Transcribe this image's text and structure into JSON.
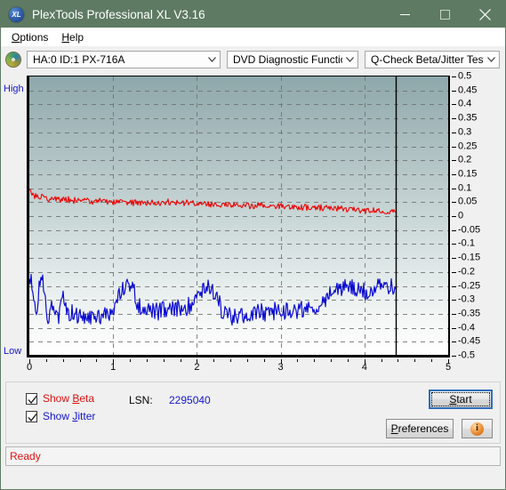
{
  "window": {
    "title": "PlexTools Professional XL V3.16",
    "app_icon": "xl-disc-icon",
    "minimize_label": "Minimize",
    "maximize_label": "Maximize",
    "close_label": "Close"
  },
  "menu": {
    "items": [
      {
        "label": "Options",
        "accel": "O"
      },
      {
        "label": "Help",
        "accel": "H"
      }
    ]
  },
  "toolbar": {
    "drive_icon": "optical-disc-icon",
    "drive_select": "HA:0 ID:1  PX-716A",
    "function_select": "DVD Diagnostic Functions",
    "test_select": "Q-Check Beta/Jitter Test"
  },
  "chart_labels": {
    "high": "High",
    "low": "Low"
  },
  "controls": {
    "show_beta": {
      "label": "Show Beta",
      "accel": "B",
      "checked": true,
      "color": "#e01010"
    },
    "show_jitter": {
      "label": "Show Jitter",
      "accel": "J",
      "checked": true,
      "color": "#1414d2"
    },
    "lsn_label": "LSN:",
    "lsn_value": "2295040",
    "start_label": "Start",
    "start_accel": "S",
    "preferences_label": "Preferences",
    "preferences_accel": "P",
    "info_label": "i",
    "info_icon": "info-icon"
  },
  "status": {
    "text": "Ready"
  },
  "colors": {
    "title_bar": "#5e7a63",
    "beta_line": "#f00000",
    "jitter_line": "#0a0ad2",
    "axis_label_blue": "#1414d2",
    "status_red": "#e01010",
    "plot_top": "#8ea8ab",
    "plot_bottom": "#ffffff"
  },
  "chart_data": {
    "type": "line",
    "title": "Q-Check Beta/Jitter Test",
    "xlabel": "",
    "ylabel": "",
    "xlim": [
      0,
      5
    ],
    "ylim": [
      -0.5,
      0.5
    ],
    "grid": true,
    "legend": "checkbox-toggles",
    "xticks": [
      0,
      1,
      2,
      3,
      4,
      5
    ],
    "yticks": [
      0.5,
      0.45,
      0.4,
      0.35,
      0.3,
      0.25,
      0.2,
      0.15,
      0.1,
      0.05,
      0,
      -0.05,
      -0.1,
      -0.15,
      -0.2,
      -0.25,
      -0.3,
      -0.35,
      -0.4,
      -0.45,
      -0.5
    ],
    "data_end_x": 4.37,
    "marker_line_x": 4.37,
    "axis_side_labels": {
      "top_left": "High",
      "bottom_left": "Low"
    },
    "series": [
      {
        "name": "Beta",
        "color": "#f00000",
        "x": [
          0.0,
          0.02,
          0.04,
          0.06,
          0.09,
          0.13,
          0.18,
          0.24,
          0.31,
          0.39,
          0.48,
          0.57,
          0.66,
          0.76,
          0.86,
          0.96,
          1.06,
          1.16,
          1.26,
          1.36,
          1.46,
          1.56,
          1.66,
          1.76,
          1.86,
          1.96,
          2.06,
          2.16,
          2.26,
          2.36,
          2.46,
          2.56,
          2.66,
          2.76,
          2.86,
          2.96,
          3.06,
          3.16,
          3.26,
          3.36,
          3.46,
          3.56,
          3.66,
          3.76,
          3.86,
          3.96,
          4.06,
          4.16,
          4.26,
          4.37
        ],
        "y": [
          0.095,
          0.085,
          0.075,
          0.072,
          0.07,
          0.068,
          0.066,
          0.064,
          0.063,
          0.06,
          0.058,
          0.056,
          0.055,
          0.054,
          0.052,
          0.051,
          0.05,
          0.05,
          0.049,
          0.048,
          0.047,
          0.044,
          0.05,
          0.048,
          0.047,
          0.045,
          0.044,
          0.043,
          0.042,
          0.041,
          0.04,
          0.038,
          0.036,
          0.038,
          0.036,
          0.034,
          0.033,
          0.032,
          0.031,
          0.03,
          0.029,
          0.028,
          0.027,
          0.026,
          0.024,
          0.022,
          0.021,
          0.02,
          0.018,
          0.016
        ],
        "noise_amplitude": 0.01
      },
      {
        "name": "Jitter",
        "color": "#0a0ad2",
        "x": [
          0.0,
          0.03,
          0.06,
          0.09,
          0.12,
          0.15,
          0.18,
          0.22,
          0.26,
          0.3,
          0.35,
          0.4,
          0.46,
          0.52,
          0.58,
          0.64,
          0.7,
          0.76,
          0.82,
          0.88,
          0.94,
          1.0,
          1.06,
          1.12,
          1.18,
          1.22,
          1.26,
          1.3,
          1.36,
          1.42,
          1.48,
          1.54,
          1.6,
          1.66,
          1.72,
          1.78,
          1.84,
          1.9,
          1.96,
          2.02,
          2.08,
          2.14,
          2.2,
          2.26,
          2.32,
          2.38,
          2.44,
          2.5,
          2.58,
          2.66,
          2.74,
          2.82,
          2.9,
          2.98,
          3.06,
          3.14,
          3.22,
          3.3,
          3.38,
          3.46,
          3.54,
          3.62,
          3.7,
          3.78,
          3.86,
          3.94,
          4.02,
          4.1,
          4.18,
          4.26,
          4.32,
          4.37
        ],
        "y": [
          -0.215,
          -0.245,
          -0.3,
          -0.345,
          -0.255,
          -0.225,
          -0.255,
          -0.385,
          -0.31,
          -0.33,
          -0.355,
          -0.3,
          -0.335,
          -0.35,
          -0.36,
          -0.365,
          -0.362,
          -0.358,
          -0.355,
          -0.348,
          -0.345,
          -0.34,
          -0.3,
          -0.26,
          -0.24,
          -0.25,
          -0.28,
          -0.32,
          -0.33,
          -0.335,
          -0.34,
          -0.345,
          -0.342,
          -0.34,
          -0.338,
          -0.335,
          -0.33,
          -0.32,
          -0.3,
          -0.27,
          -0.255,
          -0.25,
          -0.27,
          -0.31,
          -0.35,
          -0.36,
          -0.362,
          -0.358,
          -0.355,
          -0.35,
          -0.348,
          -0.345,
          -0.343,
          -0.34,
          -0.338,
          -0.336,
          -0.335,
          -0.332,
          -0.33,
          -0.32,
          -0.3,
          -0.275,
          -0.255,
          -0.25,
          -0.262,
          -0.275,
          -0.27,
          -0.265,
          -0.258,
          -0.25,
          -0.255,
          -0.248
        ],
        "noise_amplitude": 0.03
      }
    ]
  }
}
